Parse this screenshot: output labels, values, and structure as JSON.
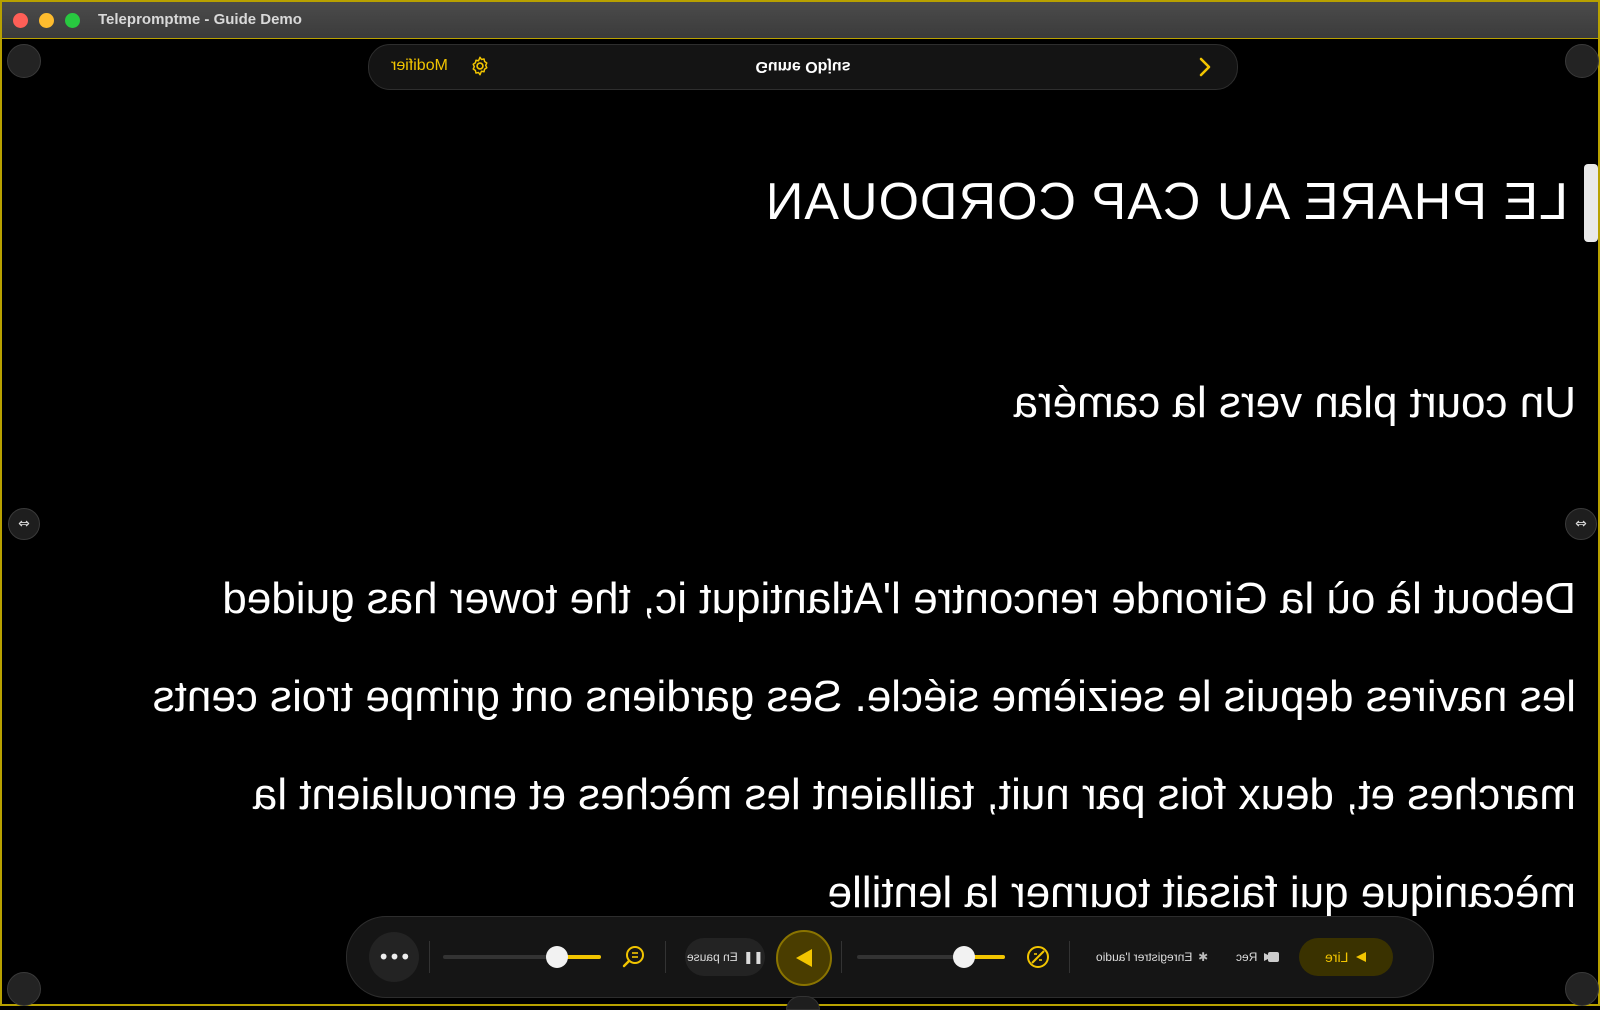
{
  "window": {
    "title": "Telepromptme - Guide Demo"
  },
  "topbar": {
    "modifier_label": "Modifier",
    "document_title": "Gume Objus"
  },
  "script": {
    "heading": "LE PHARE AU CAP CORDOUAN",
    "subheading": "Un court plan vers la caméra",
    "paragraph_lines": [
      "Debout là où la Gironde rencontre l'Atlantiqut ic, the tower has guided",
      "les navires depuis le seizième siécle. Ses gardiens ont grimpe trois cents",
      "marches et, deux fois par nuit, taillaient les mèches et enroulaient la",
      "mècanique qui faisait tourner la lentille"
    ]
  },
  "toolbar": {
    "pause_label": "En pause",
    "record_audio_label": "Enregistrer l'audio",
    "rec_label": "Rec",
    "play_label": "Lire",
    "font_size_level": 0.72,
    "speed_level": 0.72
  },
  "colors": {
    "accent": "#f2c500",
    "background": "#000000",
    "text": "#ffffff"
  },
  "icons": {
    "more": "more-dots-icon",
    "zoom": "zoom-icon",
    "pause": "pause-icon",
    "play": "play-triangle-icon",
    "speed": "speed-gauge-icon",
    "record_audio": "waveform-icon",
    "rec": "camera-icon",
    "settings": "gear-icon",
    "next": "chevron-right-icon",
    "resize": "resize-horizontal-icon"
  }
}
